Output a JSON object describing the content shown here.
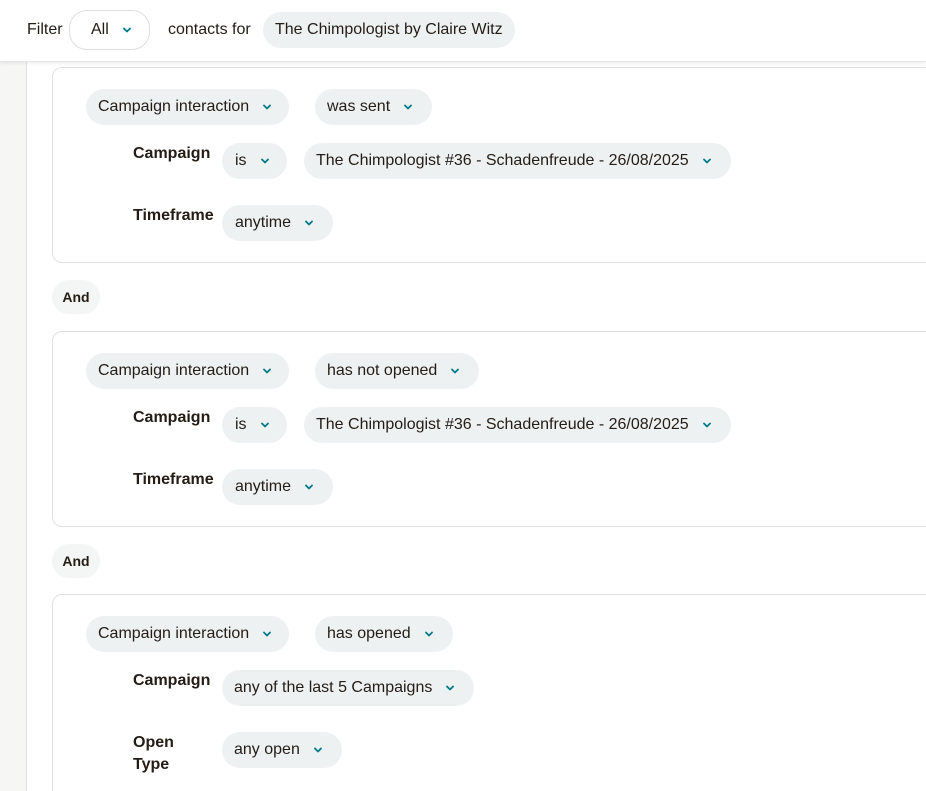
{
  "filter_bar": {
    "filter_label": "Filter",
    "scope_value": "All",
    "contacts_for_label": "contacts for",
    "audience_name": "The Chimpologist by Claire Witz"
  },
  "conditions": [
    {
      "field": "Campaign interaction",
      "operator": "was sent",
      "campaign_label": "Campaign",
      "campaign_operator": "is",
      "campaign_value": "The Chimpologist #36 - Schadenfreude - 26/08/2025",
      "timeframe_label": "Timeframe",
      "timeframe_value": "anytime"
    },
    {
      "field": "Campaign interaction",
      "operator": "has not opened",
      "campaign_label": "Campaign",
      "campaign_operator": "is",
      "campaign_value": "The Chimpologist #36 - Schadenfreude - 26/08/2025",
      "timeframe_label": "Timeframe",
      "timeframe_value": "anytime"
    },
    {
      "field": "Campaign interaction",
      "operator": "has opened",
      "campaign_label": "Campaign",
      "campaign_value": "any of the last 5 Campaigns",
      "open_type_label_line1": "Open",
      "open_type_label_line2": "Type",
      "open_type_value": "any open"
    }
  ],
  "joiners": [
    "And",
    "And"
  ],
  "colors": {
    "accent": "#007c89",
    "pill_bg": "#eef1f2",
    "text": "#241c15"
  },
  "icons": {
    "dropdown": "chevron-down-icon"
  }
}
